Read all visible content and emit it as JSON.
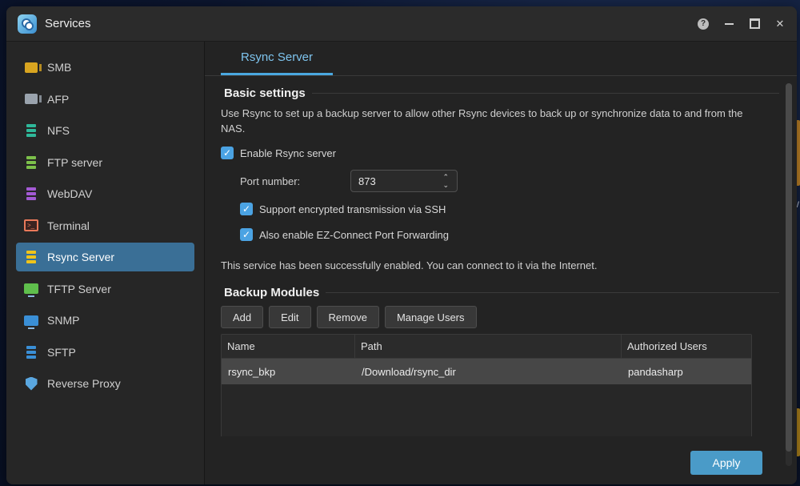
{
  "window": {
    "title": "Services",
    "controls": {
      "help": "?",
      "close": "✕"
    }
  },
  "desktop": {
    "partial_letter": "W"
  },
  "sidebar": {
    "items": [
      {
        "label": "SMB",
        "icon": "smb-folder-icon",
        "color": "#d9a520"
      },
      {
        "label": "AFP",
        "icon": "afp-folder-icon",
        "color": "#9aa3ad"
      },
      {
        "label": "NFS",
        "icon": "nfs-stack-icon",
        "color": "#2fb89a"
      },
      {
        "label": "FTP server",
        "icon": "ftp-stack-icon",
        "color": "#7cc04a"
      },
      {
        "label": "WebDAV",
        "icon": "webdav-stack-icon",
        "color": "#a35ad4"
      },
      {
        "label": "Terminal",
        "icon": "terminal-icon",
        "color": "#e9795a"
      },
      {
        "label": "Rsync Server",
        "icon": "rsync-stack-icon",
        "color": "#f0c419",
        "active": true
      },
      {
        "label": "TFTP Server",
        "icon": "tftp-monitor-icon",
        "color": "#5fbf4c"
      },
      {
        "label": "SNMP",
        "icon": "snmp-monitor-icon",
        "color": "#3a8fd6"
      },
      {
        "label": "SFTP",
        "icon": "sftp-stack-icon",
        "color": "#3a8fd6"
      },
      {
        "label": "Reverse Proxy",
        "icon": "shield-icon",
        "color": "#5aa7e0"
      }
    ]
  },
  "tabs": [
    {
      "label": "Rsync Server",
      "active": true
    }
  ],
  "basic": {
    "title": "Basic settings",
    "description": "Use Rsync to set up a backup server to allow other Rsync devices to back up or synchronize data to and from the NAS.",
    "enable_label": "Enable Rsync server",
    "port_label": "Port number:",
    "port_value": "873",
    "ssh_label": "Support encrypted transmission via SSH",
    "ezconnect_label": "Also enable EZ-Connect Port Forwarding",
    "status_message": "This service has been successfully enabled. You can connect to it via the Internet."
  },
  "modules": {
    "title": "Backup Modules",
    "buttons": {
      "add": "Add",
      "edit": "Edit",
      "remove": "Remove",
      "manage": "Manage Users"
    },
    "columns": [
      "Name",
      "Path",
      "Authorized Users"
    ],
    "rows": [
      {
        "name": "rsync_bkp",
        "path": "/Download/rsync_dir",
        "users": "pandasharp"
      }
    ]
  },
  "footer": {
    "apply": "Apply"
  },
  "colors": {
    "accent": "#4aa8e0",
    "active_nav": "#3a6f96",
    "apply": "#4a9bc8"
  }
}
